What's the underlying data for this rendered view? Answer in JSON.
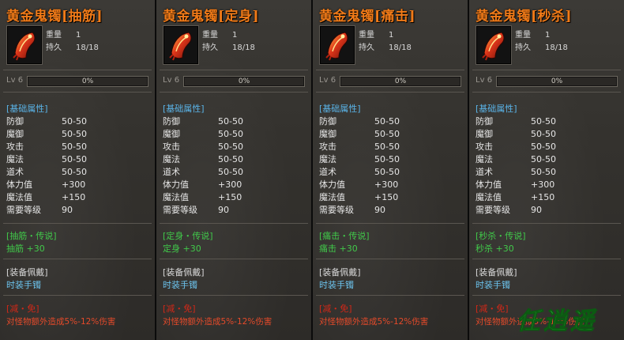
{
  "labels": {
    "weight": "重量",
    "durability": "持久",
    "level_prefix": "Lv",
    "basic_header": "[基础属性]",
    "equip_header": "[装备佩戴]",
    "equip_value": "时装手镯",
    "effect_header": "[减・免]",
    "effect_value": "对怪物额外造成5%-12%伤害"
  },
  "items": [
    {
      "title": "黄金鬼镯[抽筋]",
      "weight": "1",
      "durability": "18/18",
      "level": "6",
      "progress_text": "0%",
      "progress": 0,
      "stats": [
        {
          "k": "防御",
          "v": "50-50"
        },
        {
          "k": "魔御",
          "v": "50-50"
        },
        {
          "k": "攻击",
          "v": "50-50"
        },
        {
          "k": "魔法",
          "v": "50-50"
        },
        {
          "k": "道术",
          "v": "50-50"
        },
        {
          "k": "体力值",
          "v": "+300"
        },
        {
          "k": "魔法值",
          "v": "+150"
        },
        {
          "k": "需要等级",
          "v": "90"
        }
      ],
      "skill_header": "[抽筋・传说]",
      "skill_value": "抽筋 +30"
    },
    {
      "title": "黄金鬼镯[定身]",
      "weight": "1",
      "durability": "18/18",
      "level": "6",
      "progress_text": "0%",
      "progress": 0,
      "stats": [
        {
          "k": "防御",
          "v": "50-50"
        },
        {
          "k": "魔御",
          "v": "50-50"
        },
        {
          "k": "攻击",
          "v": "50-50"
        },
        {
          "k": "魔法",
          "v": "50-50"
        },
        {
          "k": "道术",
          "v": "50-50"
        },
        {
          "k": "体力值",
          "v": "+300"
        },
        {
          "k": "魔法值",
          "v": "+150"
        },
        {
          "k": "需要等级",
          "v": "90"
        }
      ],
      "skill_header": "[定身・传说]",
      "skill_value": "定身 +30"
    },
    {
      "title": "黄金鬼镯[痛击]",
      "weight": "1",
      "durability": "18/18",
      "level": "6",
      "progress_text": "0%",
      "progress": 0,
      "stats": [
        {
          "k": "防御",
          "v": "50-50"
        },
        {
          "k": "魔御",
          "v": "50-50"
        },
        {
          "k": "攻击",
          "v": "50-50"
        },
        {
          "k": "魔法",
          "v": "50-50"
        },
        {
          "k": "道术",
          "v": "50-50"
        },
        {
          "k": "体力值",
          "v": "+300"
        },
        {
          "k": "魔法值",
          "v": "+150"
        },
        {
          "k": "需要等级",
          "v": "90"
        }
      ],
      "skill_header": "[痛击・传说]",
      "skill_value": "痛击 +30"
    },
    {
      "title": "黄金鬼镯[秒杀]",
      "weight": "1",
      "durability": "18/18",
      "level": "6",
      "progress_text": "0%",
      "progress": 0,
      "stats": [
        {
          "k": "防御",
          "v": "50-50"
        },
        {
          "k": "魔御",
          "v": "50-50"
        },
        {
          "k": "攻击",
          "v": "50-50"
        },
        {
          "k": "魔法",
          "v": "50-50"
        },
        {
          "k": "道术",
          "v": "50-50"
        },
        {
          "k": "体力值",
          "v": "+300"
        },
        {
          "k": "魔法值",
          "v": "+150"
        },
        {
          "k": "需要等级",
          "v": "90"
        }
      ],
      "skill_header": "[秒杀・传说]",
      "skill_value": "秒杀 +30"
    }
  ],
  "icons": {
    "item": "bracelet-icon",
    "watermark": "logo-icon"
  },
  "watermark_text": "任逍遥",
  "colors": {
    "title": "#f07a18",
    "section_blue": "#5ab4e8",
    "skill_green": "#41c84a",
    "equip_blue": "#6cc4ee",
    "effect_red": "#d02818",
    "progress_fill": "#8a2a1a"
  }
}
